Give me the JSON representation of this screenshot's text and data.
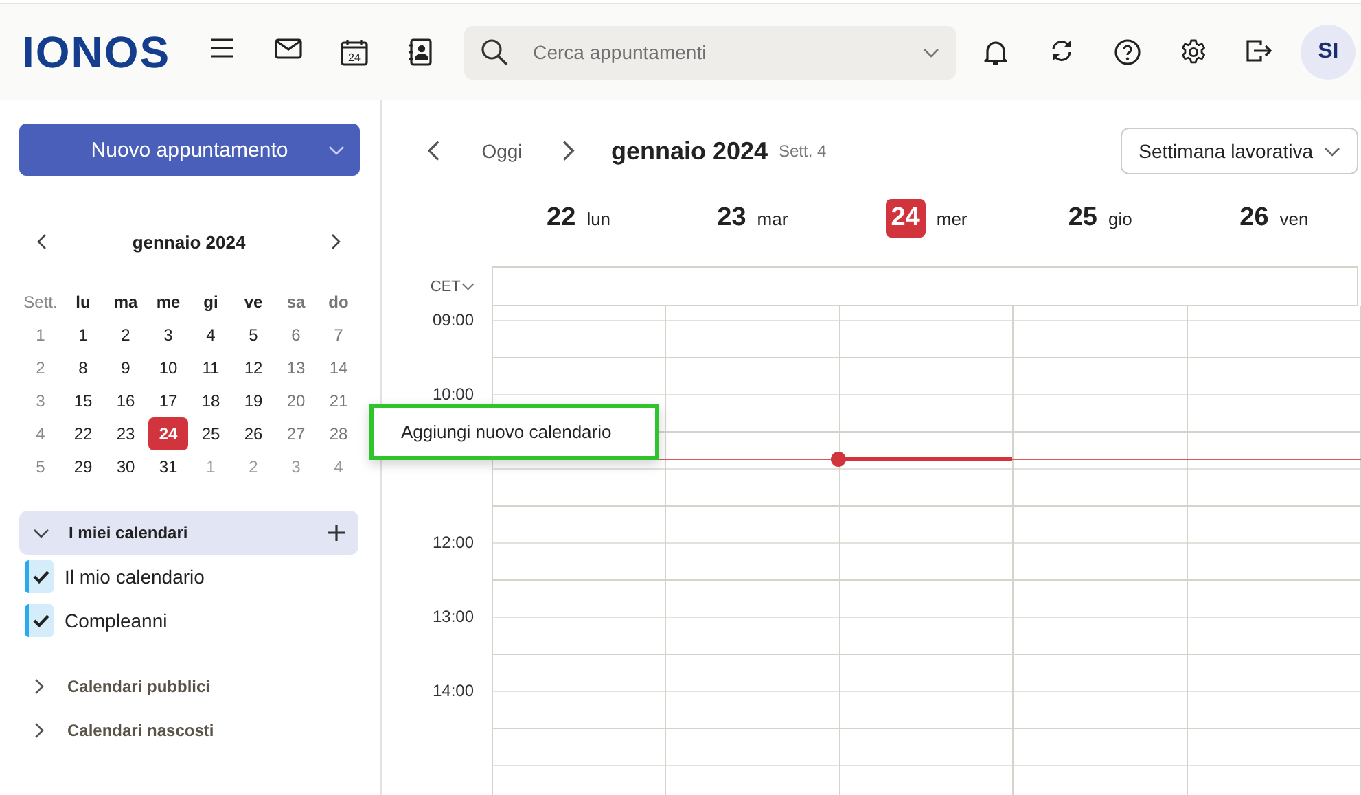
{
  "header": {
    "logo": "IONOS",
    "calendar_icon_day": "24",
    "search": {
      "placeholder": "Cerca appuntamenti"
    },
    "avatar": "SI"
  },
  "sidebar": {
    "new_button": "Nuovo appuntamento",
    "mini_calendar": {
      "title": "gennaio 2024",
      "week_label": "Sett.",
      "weekdays": [
        "lu",
        "ma",
        "me",
        "gi",
        "ve",
        "sa",
        "do"
      ],
      "weeks": [
        {
          "number": "1",
          "days": [
            {
              "label": "1",
              "outside": false,
              "selected": false
            },
            {
              "label": "2",
              "outside": false,
              "selected": false
            },
            {
              "label": "3",
              "outside": false,
              "selected": false
            },
            {
              "label": "4",
              "outside": false,
              "selected": false
            },
            {
              "label": "5",
              "outside": false,
              "selected": false
            },
            {
              "label": "6",
              "outside": false,
              "selected": false
            },
            {
              "label": "7",
              "outside": false,
              "selected": false
            }
          ]
        },
        {
          "number": "2",
          "days": [
            {
              "label": "8",
              "outside": false,
              "selected": false
            },
            {
              "label": "9",
              "outside": false,
              "selected": false
            },
            {
              "label": "10",
              "outside": false,
              "selected": false
            },
            {
              "label": "11",
              "outside": false,
              "selected": false
            },
            {
              "label": "12",
              "outside": false,
              "selected": false
            },
            {
              "label": "13",
              "outside": false,
              "selected": false
            },
            {
              "label": "14",
              "outside": false,
              "selected": false
            }
          ]
        },
        {
          "number": "3",
          "days": [
            {
              "label": "15",
              "outside": false,
              "selected": false
            },
            {
              "label": "16",
              "outside": false,
              "selected": false
            },
            {
              "label": "17",
              "outside": false,
              "selected": false
            },
            {
              "label": "18",
              "outside": false,
              "selected": false
            },
            {
              "label": "19",
              "outside": false,
              "selected": false
            },
            {
              "label": "20",
              "outside": false,
              "selected": false
            },
            {
              "label": "21",
              "outside": false,
              "selected": false
            }
          ]
        },
        {
          "number": "4",
          "days": [
            {
              "label": "22",
              "outside": false,
              "selected": false
            },
            {
              "label": "23",
              "outside": false,
              "selected": false
            },
            {
              "label": "24",
              "outside": false,
              "selected": true
            },
            {
              "label": "25",
              "outside": false,
              "selected": false
            },
            {
              "label": "26",
              "outside": false,
              "selected": false
            },
            {
              "label": "27",
              "outside": false,
              "selected": false
            },
            {
              "label": "28",
              "outside": false,
              "selected": false
            }
          ]
        },
        {
          "number": "5",
          "days": [
            {
              "label": "29",
              "outside": false,
              "selected": false
            },
            {
              "label": "30",
              "outside": false,
              "selected": false
            },
            {
              "label": "31",
              "outside": false,
              "selected": false
            },
            {
              "label": "1",
              "outside": true,
              "selected": false
            },
            {
              "label": "2",
              "outside": true,
              "selected": false
            },
            {
              "label": "3",
              "outside": true,
              "selected": false
            },
            {
              "label": "4",
              "outside": true,
              "selected": false
            }
          ]
        }
      ]
    },
    "my_calendars": {
      "label": "I miei calendari",
      "expanded": true,
      "items": [
        {
          "name": "Il mio calendario",
          "checked": true,
          "color": "#29a9f0"
        },
        {
          "name": "Compleanni",
          "checked": true,
          "color": "#29a9f0"
        }
      ]
    },
    "sections": [
      {
        "label": "Calendari pubblici",
        "expanded": false
      },
      {
        "label": "Calendari nascosti",
        "expanded": false
      }
    ]
  },
  "toolbar": {
    "today": "Oggi",
    "title": "gennaio 2024",
    "week": "Sett. 4",
    "view": "Settimana lavorativa"
  },
  "days": [
    {
      "number": "22",
      "name": "lun",
      "selected": false
    },
    {
      "number": "23",
      "name": "mar",
      "selected": false
    },
    {
      "number": "24",
      "name": "mer",
      "selected": true
    },
    {
      "number": "25",
      "name": "gio",
      "selected": false
    },
    {
      "number": "26",
      "name": "ven",
      "selected": false
    }
  ],
  "timezone": "CET",
  "hours_above_menu": [
    "09:00",
    "10:00"
  ],
  "hours_below_menu": [
    "12:00",
    "13:00",
    "14:00"
  ],
  "popup": {
    "item": "Aggiungi nuovo calendario",
    "highlighted": true
  }
}
